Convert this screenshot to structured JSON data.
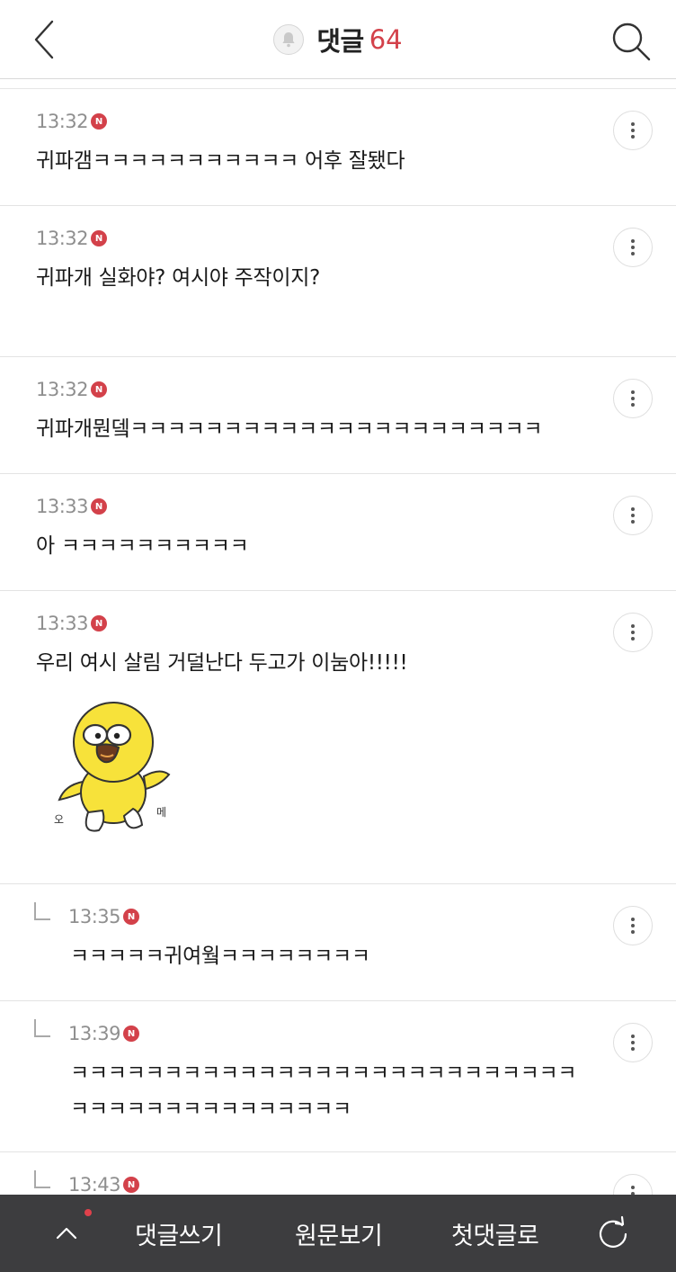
{
  "header": {
    "title": "댓글",
    "count": "64",
    "back_icon": "chevron-left-icon",
    "bell_icon": "bell-icon",
    "search_icon": "search-icon"
  },
  "comments": [
    {
      "time": "13:32",
      "badge": "N",
      "text": "귀파갬ㅋㅋㅋㅋㅋㅋㅋㅋㅋㅋㅋ 어후 잘됐다",
      "is_reply": false
    },
    {
      "time": "13:32",
      "badge": "N",
      "text": "귀파개 실화야? 여시야 주작이지?",
      "is_reply": false
    },
    {
      "time": "13:32",
      "badge": "N",
      "text": "귀파개뭔뎈ㅋㅋㅋㅋㅋㅋㅋㅋㅋㅋㅋㅋㅋㅋㅋㅋㅋㅋㅋㅋㅋㅋ",
      "is_reply": false
    },
    {
      "time": "13:33",
      "badge": "N",
      "text": "아 ㅋㅋㅋㅋㅋㅋㅋㅋㅋㅋ",
      "is_reply": false
    },
    {
      "time": "13:33",
      "badge": "N",
      "text": "우리 여시 살림 거덜난다 두고가 이눔아!!!!!",
      "is_reply": false,
      "sticker": {
        "name": "yellow-chick-sticker",
        "left_text": "오",
        "right_text": "메"
      }
    },
    {
      "time": "13:35",
      "badge": "N",
      "text": "ㅋㅋㅋㅋㅋ귀여웤ㅋㅋㅋㅋㅋㅋㅋㅋ",
      "is_reply": true
    },
    {
      "time": "13:39",
      "badge": "N",
      "text_lines": [
        "ㅋㅋㅋㅋㅋㅋㅋㅋㅋㅋㅋㅋㅋㅋㅋㅋㅋㅋㅋㅋㅋㅋㅋㅋㅋㅋㅋ",
        "ㅋㅋㅋㅋㅋㅋㅋㅋㅋㅋㅋㅋㅋㅋㅋ"
      ],
      "is_reply": true
    },
    {
      "time": "13:43",
      "badge": "N",
      "text": "",
      "is_reply": true
    }
  ],
  "bottom_bar": {
    "write_label": "댓글쓰기",
    "original_label": "원문보기",
    "first_label": "첫댓글로",
    "up_icon": "chevron-up-icon",
    "refresh_icon": "refresh-icon",
    "colors": {
      "background": "#3d3d3f",
      "accent": "#d3414a"
    }
  }
}
